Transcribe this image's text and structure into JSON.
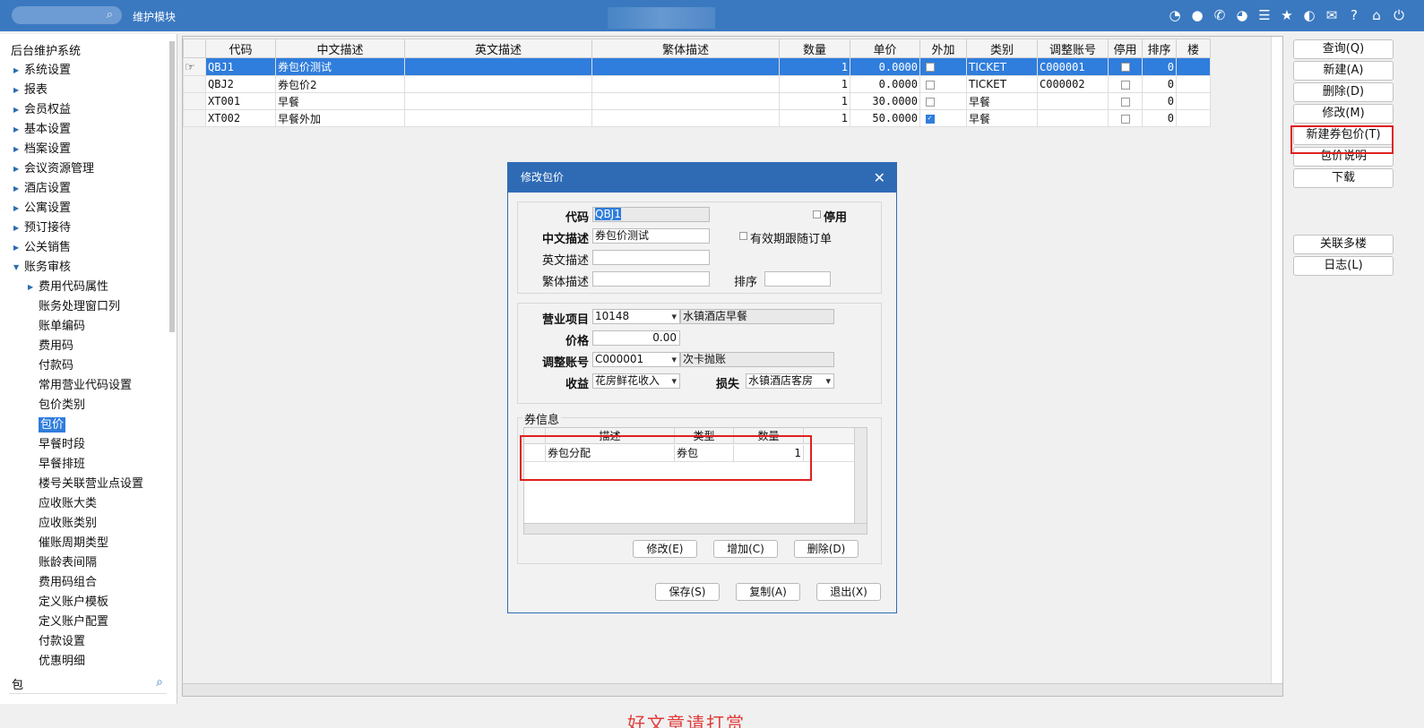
{
  "topbar": {
    "module_title": "维护模块",
    "icons": [
      "wifi-icon",
      "chat-icon",
      "phone-icon",
      "palette-icon",
      "menu-icon",
      "star-icon",
      "theme-icon",
      "mail-icon",
      "help-icon",
      "home-icon",
      "power-icon"
    ]
  },
  "sidebar": {
    "root": "后台维护系统",
    "items": [
      {
        "label": "系统设置",
        "level": 1,
        "arrow": "right"
      },
      {
        "label": "报表",
        "level": 1,
        "arrow": "right"
      },
      {
        "label": "会员权益",
        "level": 1,
        "arrow": "right"
      },
      {
        "label": "基本设置",
        "level": 1,
        "arrow": "right"
      },
      {
        "label": "档案设置",
        "level": 1,
        "arrow": "right"
      },
      {
        "label": "会议资源管理",
        "level": 1,
        "arrow": "right"
      },
      {
        "label": "酒店设置",
        "level": 1,
        "arrow": "right"
      },
      {
        "label": "公寓设置",
        "level": 1,
        "arrow": "right"
      },
      {
        "label": "预订接待",
        "level": 1,
        "arrow": "right"
      },
      {
        "label": "公关销售",
        "level": 1,
        "arrow": "right"
      },
      {
        "label": "账务审核",
        "level": 1,
        "arrow": "down"
      },
      {
        "label": "费用代码属性",
        "level": 2,
        "arrow": "right"
      },
      {
        "label": "账务处理窗口列",
        "level": 2,
        "arrow": ""
      },
      {
        "label": "账单编码",
        "level": 2,
        "arrow": ""
      },
      {
        "label": "费用码",
        "level": 2,
        "arrow": ""
      },
      {
        "label": "付款码",
        "level": 2,
        "arrow": ""
      },
      {
        "label": "常用营业代码设置",
        "level": 2,
        "arrow": ""
      },
      {
        "label": "包价类别",
        "level": 2,
        "arrow": ""
      },
      {
        "label": "包价",
        "level": 2,
        "arrow": "",
        "selected": true
      },
      {
        "label": "早餐时段",
        "level": 2,
        "arrow": ""
      },
      {
        "label": "早餐排班",
        "level": 2,
        "arrow": ""
      },
      {
        "label": "楼号关联营业点设置",
        "level": 2,
        "arrow": ""
      },
      {
        "label": "应收账大类",
        "level": 2,
        "arrow": ""
      },
      {
        "label": "应收账类别",
        "level": 2,
        "arrow": ""
      },
      {
        "label": "催账周期类型",
        "level": 2,
        "arrow": ""
      },
      {
        "label": "账龄表间隔",
        "level": 2,
        "arrow": ""
      },
      {
        "label": "费用码组合",
        "level": 2,
        "arrow": ""
      },
      {
        "label": "定义账户模板",
        "level": 2,
        "arrow": ""
      },
      {
        "label": "定义账户配置",
        "level": 2,
        "arrow": ""
      },
      {
        "label": "付款设置",
        "level": 2,
        "arrow": ""
      },
      {
        "label": "优惠明细",
        "level": 2,
        "arrow": ""
      }
    ],
    "search_value": "包"
  },
  "grid": {
    "columns": [
      "代码",
      "中文描述",
      "英文描述",
      "繁体描述",
      "数量",
      "单价",
      "外加",
      "类别",
      "调整账号",
      "停用",
      "排序",
      "楼"
    ],
    "rows": [
      {
        "code": "QBJ1",
        "cn": "券包价测试",
        "en": "",
        "tw": "",
        "qty": "1",
        "price": "0.0000",
        "extra": false,
        "type": "TICKET",
        "acct": "C000001",
        "disabled": false,
        "sort": "0",
        "selected": true
      },
      {
        "code": "QBJ2",
        "cn": "券包价2",
        "en": "",
        "tw": "",
        "qty": "1",
        "price": "0.0000",
        "extra": false,
        "type": "TICKET",
        "acct": "C000002",
        "disabled": false,
        "sort": "0"
      },
      {
        "code": "XT001",
        "cn": "早餐",
        "en": "",
        "tw": "",
        "qty": "1",
        "price": "30.0000",
        "extra": false,
        "type": "早餐",
        "acct": "",
        "disabled": false,
        "sort": "0"
      },
      {
        "code": "XT002",
        "cn": "早餐外加",
        "en": "",
        "tw": "",
        "qty": "1",
        "price": "50.0000",
        "extra": true,
        "type": "早餐",
        "acct": "",
        "disabled": false,
        "sort": "0"
      }
    ]
  },
  "right_buttons": {
    "query": "查询(Q)",
    "new": "新建(A)",
    "delete": "删除(D)",
    "modify": "修改(M)",
    "new_voucher": "新建券包价(T)",
    "note": "包价说明",
    "download": "下载",
    "link_buildings": "关联多楼",
    "log": "日志(L)"
  },
  "dialog": {
    "title": "修改包价",
    "code_label": "代码",
    "code_value": "QBJ1",
    "stop_label": "停用",
    "cn_label": "中文描述",
    "cn_value": "券包价测试",
    "validity_label": "有效期跟随订单",
    "en_label": "英文描述",
    "en_value": "",
    "tw_label": "繁体描述",
    "tw_value": "",
    "sort_label": "排序",
    "sort_value": "",
    "biz_label": "营业项目",
    "biz_value": "10148",
    "biz_desc": "水镇酒店早餐",
    "price_label": "价格",
    "price_value": "0.00",
    "acct_label": "调整账号",
    "acct_value": "C000001",
    "acct_desc": "次卡抛账",
    "income_label": "收益",
    "income_value": "花房鲜花收入",
    "loss_label": "损失",
    "loss_value": "水镇酒店客房",
    "voucher_section": "券信息",
    "voucher_columns": [
      "描述",
      "类型",
      "数量"
    ],
    "voucher_rows": [
      {
        "desc": "券包分配",
        "type": "券包",
        "qty": "1"
      }
    ],
    "btn_edit": "修改(E)",
    "btn_add": "增加(C)",
    "btn_del": "删除(D)",
    "btn_save": "保存(S)",
    "btn_copy": "复制(A)",
    "btn_exit": "退出(X)"
  },
  "footer_overlay": "好文章请打赏",
  "colors": {
    "topbar": "#3a79c0",
    "selection": "#2f7ddc",
    "dialog_title": "#2f6bb5",
    "highlight_box": "#e02020"
  }
}
